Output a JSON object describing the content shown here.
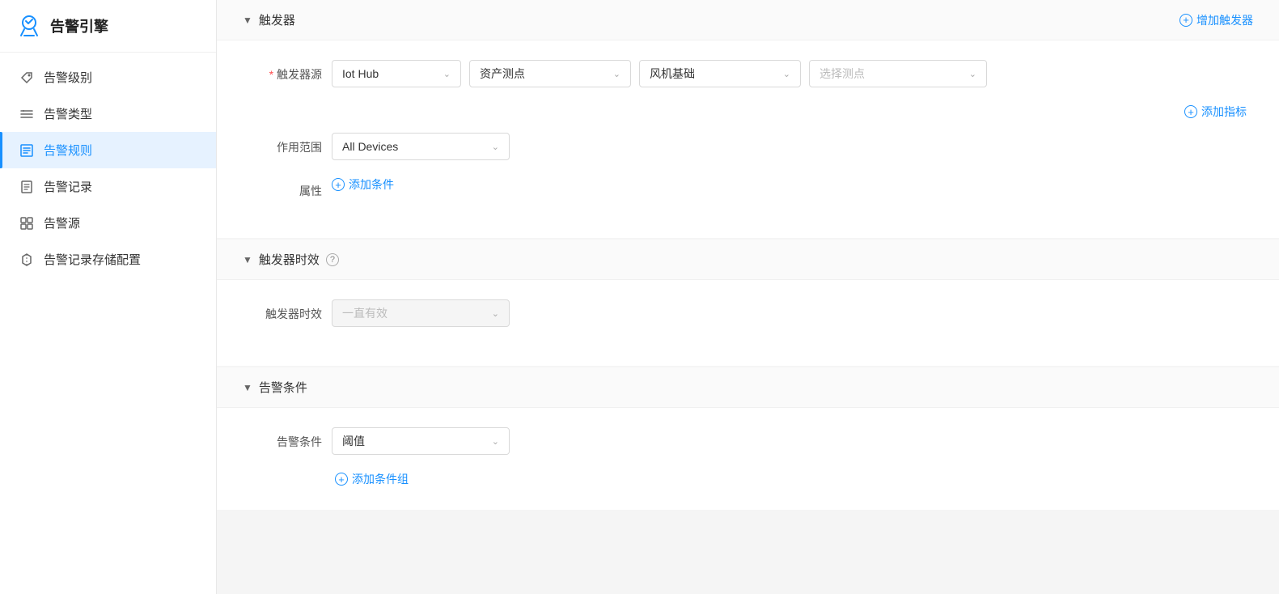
{
  "sidebar": {
    "header": {
      "title": "告警引擎",
      "icon": "alarm-engine"
    },
    "items": [
      {
        "id": "alarm-level",
        "label": "告警级别",
        "icon": "tag-icon",
        "active": false
      },
      {
        "id": "alarm-type",
        "label": "告警类型",
        "icon": "list-icon",
        "active": false
      },
      {
        "id": "alarm-rule",
        "label": "告警规则",
        "icon": "rule-icon",
        "active": true
      },
      {
        "id": "alarm-record",
        "label": "告警记录",
        "icon": "record-icon",
        "active": false
      },
      {
        "id": "alarm-source",
        "label": "告警源",
        "icon": "source-icon",
        "active": false
      },
      {
        "id": "alarm-storage",
        "label": "告警记录存储配置",
        "icon": "storage-icon",
        "active": false
      }
    ]
  },
  "sections": {
    "trigger": {
      "header": "触发器",
      "add_label": "增加触发器",
      "source_label": "触发器源",
      "source_required": true,
      "source_options": [
        "Iot Hub",
        "资产测点",
        "风机基础"
      ],
      "source_selected": [
        "Iot Hub",
        "资产测点",
        "风机基础"
      ],
      "source_placeholder": "选择测点",
      "add_metrics_label": "添加指标",
      "scope_label": "作用范围",
      "scope_selected": "All Devices",
      "attr_label": "属性",
      "add_condition_label": "添加条件"
    },
    "trigger_validity": {
      "header": "触发器时效",
      "validity_label": "触发器时效",
      "validity_placeholder": "一直有效"
    },
    "alarm_condition": {
      "header": "告警条件",
      "condition_label": "告警条件",
      "condition_selected": "阈值",
      "add_group_label": "添加条件组"
    }
  }
}
